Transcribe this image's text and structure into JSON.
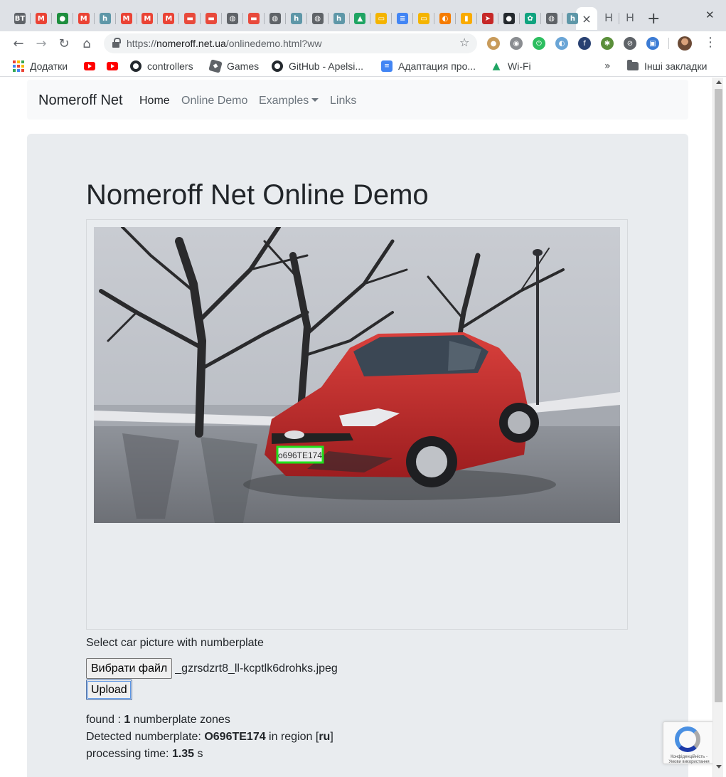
{
  "browser": {
    "url_scheme": "https://",
    "url_host": "nomeroff.net.ua",
    "url_path": "/onlinedemo.html?ww",
    "active_tab_close": "×",
    "partial_tab_1": "H",
    "partial_tab_2": "H",
    "tab_favicons": [
      {
        "name": "bt",
        "color": "#5f6368",
        "text": "BT"
      },
      {
        "name": "gmail",
        "color": "#ea4335",
        "text": "M"
      },
      {
        "name": "frog",
        "color": "#1e8e3e",
        "text": "●"
      },
      {
        "name": "gmail",
        "color": "#ea4335",
        "text": "M"
      },
      {
        "name": "h",
        "color": "#5e97a8",
        "text": "h"
      },
      {
        "name": "gmail",
        "color": "#ea4335",
        "text": "M"
      },
      {
        "name": "gmail",
        "color": "#ea4335",
        "text": "M"
      },
      {
        "name": "gmail",
        "color": "#ea4335",
        "text": "M"
      },
      {
        "name": "car",
        "color": "#e84a3c",
        "text": "▬"
      },
      {
        "name": "car",
        "color": "#e84a3c",
        "text": "▬"
      },
      {
        "name": "globe",
        "color": "#5f6368",
        "text": "◍"
      },
      {
        "name": "car",
        "color": "#e84a3c",
        "text": "▬"
      },
      {
        "name": "globe",
        "color": "#5f6368",
        "text": "◍"
      },
      {
        "name": "h",
        "color": "#5e97a8",
        "text": "h"
      },
      {
        "name": "globe",
        "color": "#5f6368",
        "text": "◍"
      },
      {
        "name": "h",
        "color": "#5e97a8",
        "text": "h"
      },
      {
        "name": "drive",
        "color": "#1fa463",
        "text": "▲"
      },
      {
        "name": "slides",
        "color": "#f4b400",
        "text": "▭"
      },
      {
        "name": "docs",
        "color": "#4285f4",
        "text": "≡"
      },
      {
        "name": "slides",
        "color": "#f4b400",
        "text": "▭"
      },
      {
        "name": "orange",
        "color": "#f57c00",
        "text": "◐"
      },
      {
        "name": "analytics",
        "color": "#f9ab00",
        "text": "▮"
      },
      {
        "name": "bird",
        "color": "#c62828",
        "text": "➤"
      },
      {
        "name": "github",
        "color": "#24292e",
        "text": "●"
      },
      {
        "name": "openai",
        "color": "#10a37f",
        "text": "✿"
      },
      {
        "name": "globe",
        "color": "#5f6368",
        "text": "◍"
      },
      {
        "name": "h",
        "color": "#5e97a8",
        "text": "h"
      }
    ],
    "extensions": [
      {
        "name": "cookie",
        "color": "#c89b5a",
        "text": "●"
      },
      {
        "name": "camera",
        "color": "#8a8d91",
        "text": "◉"
      },
      {
        "name": "evernote",
        "color": "#2dbe60",
        "text": "⏻"
      },
      {
        "name": "sidebar",
        "color": "#6aa5d6",
        "text": "◐"
      },
      {
        "name": "fedora",
        "color": "#294172",
        "text": "f"
      },
      {
        "name": "tree",
        "color": "#5a8f3a",
        "text": "✱"
      },
      {
        "name": "compass",
        "color": "#5f6368",
        "text": "⊘"
      },
      {
        "name": "capture",
        "color": "#3b7bd4",
        "text": "▣"
      }
    ],
    "bookmarks": [
      {
        "name": "apps",
        "label": "Додатки"
      },
      {
        "name": "youtube-1",
        "label": ""
      },
      {
        "name": "youtube-2",
        "label": ""
      },
      {
        "name": "controllers",
        "label": "controllers"
      },
      {
        "name": "games",
        "label": "Games"
      },
      {
        "name": "github-apelsin",
        "label": "GitHub - Apelsi..."
      },
      {
        "name": "adaptation",
        "label": "Адаптация про..."
      },
      {
        "name": "wifi",
        "label": "Wi-Fi"
      }
    ],
    "bookmarks_more": "»",
    "other_bookmarks": "Інші закладки"
  },
  "page": {
    "brand": "Nomeroff Net",
    "nav": {
      "home": "Home",
      "online_demo": "Online Demo",
      "examples": "Examples",
      "links": "Links"
    },
    "title": "Nomeroff Net Online Demo",
    "plate_text": "o696TE174",
    "select_label": "Select car picture with numberplate",
    "choose_file_button": "Вибрати файл",
    "file_name": "_gzrsdzrt8_ll-kcptlk6drohks.jpeg",
    "upload_button": "Upload",
    "result": {
      "found_prefix": "found : ",
      "found_count": "1",
      "found_suffix": " numberplate zones",
      "detected_prefix": "Detected numberplate: ",
      "detected_plate": "O696TE174",
      "region_prefix": " in region [",
      "region": "ru",
      "region_suffix": "]",
      "time_prefix": "processing time: ",
      "time_value": "1.35",
      "time_suffix": " s"
    },
    "recaptcha_text": "Конфіденційність - Умови використання"
  },
  "colors": {
    "navbar_bg": "#f8f9fa",
    "jumbotron_bg": "#e9ecef",
    "detection_box": "#22e01c",
    "car_red": "#c4282a"
  }
}
